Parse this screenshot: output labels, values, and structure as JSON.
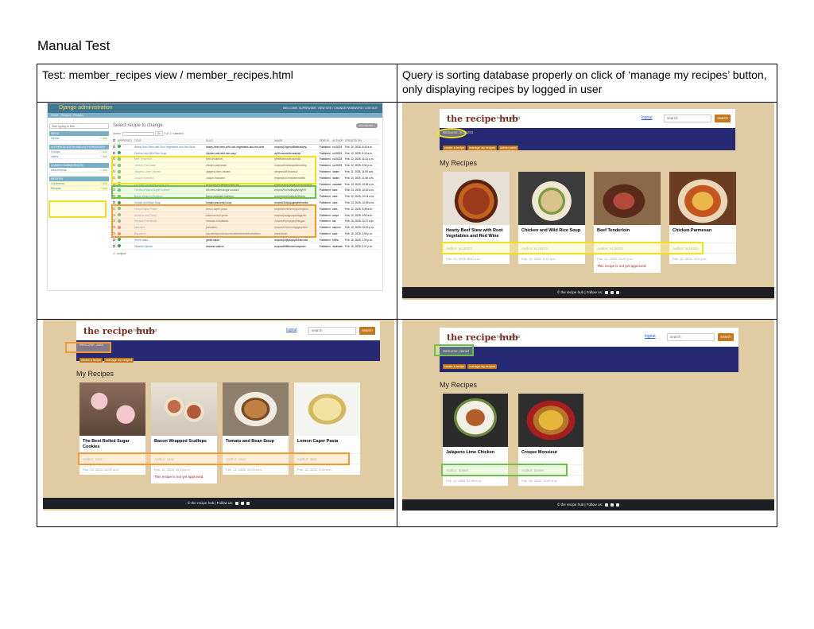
{
  "page": {
    "title": "Manual Test",
    "test_label": "Test:  member_recipes view / member_recipes.html",
    "result_text": "Query is sorting database properly on click of ‘manage my recipes’ button, only displaying recipes by logged in user"
  },
  "admin": {
    "site_title": "Django administration",
    "user_bar": "WELCOME, SUPERUSER. VIEW SITE / CHANGE PASSWORD / LOG OUT",
    "breadcrumb": "Home › Recipes › Recipes",
    "filter_placeholder": "Start typing to filter...",
    "apps": [
      {
        "name": "MENU",
        "models": [
          {
            "label": "Menus",
            "add": "+ Add"
          }
        ]
      },
      {
        "name": "AUTHENTICATION AND AUTHORIZATION",
        "models": [
          {
            "label": "Groups",
            "add": "+ Add"
          },
          {
            "label": "Users",
            "add": "+ Add"
          }
        ]
      },
      {
        "name": "DJANGO SUMMERNOTE",
        "models": [
          {
            "label": "Attachments",
            "add": "+ Add"
          }
        ]
      },
      {
        "name": "RECIPES",
        "models": [
          {
            "label": "Comments",
            "add": "+ Add"
          },
          {
            "label": "Recipes",
            "add": "+ Add"
          }
        ]
      }
    ],
    "heading": "Select recipe to change",
    "add_button": "ADD RECIPE +",
    "actions_label": "Action:",
    "go": "Go",
    "selected": "0 of 17 selected",
    "columns": [
      "APPROVED",
      "TITLE",
      "SLUG",
      "IMAGE",
      "STATUS",
      "AUTHOR",
      "CREATED ON"
    ],
    "rows": [
      {
        "ok": true,
        "title": "Hearty Beef Stew with Root Vegetables and Red Wine",
        "slug": "hearty-beef-stew-with-root-vegetables-and-red-wine",
        "image": "recipes/j2hgmcu8fkebxkbjeyl",
        "status": "Published",
        "author": "sc15223",
        "created": "Feb. 10, 2025, 8:40 a.m."
      },
      {
        "ok": true,
        "title": "Chicken and Wild Rice Soup",
        "slug": "chicken-and-wild-rice-soup",
        "image": "ay02omcmebhmeaniail",
        "status": "Published",
        "author": "sc15223",
        "created": "Feb. 12, 2025, 5:10 a.m."
      },
      {
        "ok": true,
        "title": "Beef Tenderloin",
        "slug": "beef-tenderloin",
        "image": "g9m9ktmmovbvanmolb",
        "status": "Published",
        "author": "sc15223",
        "created": "Feb. 12, 2025, 11:21 p.m."
      },
      {
        "ok": true,
        "title": "Chicken Parmesan",
        "slug": "chicken-parmesan",
        "image": "recipes/ffmtmbivpdhmonf0ny",
        "status": "Published",
        "author": "sc15223",
        "created": "Feb. 12, 2025, 3:51 p.m."
      },
      {
        "ok": true,
        "title": "Jalapeno Lime Chicken",
        "slug": "jalapeno-lime-chicken",
        "image": "xzhgmcu8f7dhduxc4",
        "status": "Published",
        "author": "daniel",
        "created": "Feb. 11, 2025, 11:09 a.m."
      },
      {
        "ok": true,
        "title": "Croque Monsieur",
        "slug": "croque-monsieur",
        "image": "recipes/loi7zrnlvbkrhmoa9y",
        "status": "Published",
        "author": "daniel",
        "created": "Feb. 10, 2025, 11:40 a.m."
      },
      {
        "ok": true,
        "title": "Overnight Breakfast Casserole",
        "slug": "overnight-breakfast-casserole",
        "image": "recipes/jwfgmcuiqivkydhmuddwch",
        "status": "Published",
        "author": "michelle",
        "created": "Feb. 13, 2025, 10:04 a.m."
      },
      {
        "ok": true,
        "title": "The Best Rolled Sugar Cookies",
        "slug": "the-best-rolled-sugar-cookies",
        "image": "recipes/0m0wdbkg8yshgfn9",
        "status": "Published",
        "author": "sara",
        "created": "Feb. 13, 2025, 10:02 a.m."
      },
      {
        "ok": true,
        "title": "Bacon Wrapped Scallops",
        "slug": "bacon-wrapped-scallops",
        "image": "recipes/giqr0wsltu1d38nmq",
        "status": "Published",
        "author": "sara",
        "created": "Feb. 12, 2025, 10:14 a.m."
      },
      {
        "ok": true,
        "title": "Tomato and Bean Soup",
        "slug": "tomato-and-bean-soup",
        "image": "recipes/4htpyqugmgbvfhmhke",
        "status": "Published",
        "author": "sara",
        "created": "Feb. 13, 2025, 10:09 a.m."
      },
      {
        "ok": true,
        "title": "Lemon Caper Pasta",
        "slug": "lemon-caper-pasta",
        "image": "recipes/bzhbewmvyuvvhqkiuu",
        "status": "Published",
        "author": "sara",
        "created": "Feb. 12, 2025, 9:39 a.m."
      },
      {
        "ok": true,
        "title": "Hummus and Pesto",
        "slug": "hummus-and-pesto",
        "image": "recipes/jozsjzpuqcubbgqvfm",
        "status": "Published",
        "author": "tanya",
        "created": "Feb. 10, 2025, 4:52 a.m."
      },
      {
        "ok": true,
        "title": "Mexican Enchiladas",
        "slug": "mexican-enchiladas",
        "image": "recipes/hfp4xpqvbpfhfsgjxz",
        "status": "Published",
        "author": "kat",
        "created": "Feb. 10, 2025, 11:17 a.m."
      },
      {
        "ok": false,
        "title": "pancakes",
        "slug": "pancakes",
        "image": "recipes/hhz1rmmxgqpdyhibid",
        "status": "Published",
        "author": "sammo",
        "created": "Feb. 12, 2025, 12:12 p.m."
      },
      {
        "ok": false,
        "title": "Biscotmtis",
        "slug": "biscotmtiscromkcmunicmeblecfcivmediumstioms",
        "image": "placeholder",
        "status": "Published",
        "author": "sara",
        "created": "Feb. 10, 2025, 2:53 p.m."
      },
      {
        "ok": true,
        "title": "Greek salad",
        "slug": "greek-salad",
        "image": "recipes/p4j8ysqoqt3t4wbco6d",
        "status": "Published",
        "author": "bhilia",
        "created": "Feb. 10, 2025, 1:30 p.m."
      },
      {
        "ok": true,
        "title": "Sesame Salmon",
        "slug": "sesame-salmon",
        "image": "recipes/fbfl6hmcnfmclpecbs",
        "status": "Published",
        "author": "ibrahsam",
        "created": "Feb. 10, 2025, 2:07 p.m."
      }
    ],
    "count": "17 recipes"
  },
  "hub": {
    "brand": "the recipe hub",
    "nav_home": "home",
    "nav_about": "about",
    "logout": "logout",
    "search_placeholder": "search",
    "search_button": "search",
    "create_button": "create a recipe",
    "manage_button": "manage my recipes",
    "admin_button": "admin panel",
    "heading": "My Recipes",
    "footer": "© the recipe hub | Follow us:",
    "not_approved": "This recipe is not yet approved."
  },
  "panels": {
    "sc": {
      "welcome": "Welcome, sc15223",
      "cards": [
        {
          "title": "Hearty Beef Stew with Root Vegetables and Red Wine",
          "author": "Author: sc15223",
          "date": "Feb. 10, 2025, 8:40 a.m.",
          "img": "stew"
        },
        {
          "title": "Chicken and Wild Rice Soup",
          "author": "Author: sc15223",
          "date": "Feb. 12, 2025, 5:10 a.m.",
          "img": "soup"
        },
        {
          "title": "Beef Tenderloin",
          "author": "Author: sc15223",
          "date": "Feb. 12, 2025, 11:20 p.m.",
          "img": "beef",
          "pending": true
        },
        {
          "title": "Chicken Parmesan",
          "author": "Author: sc15223",
          "date": "Feb. 12, 2025, 3:51 p.m.",
          "img": "parm"
        }
      ]
    },
    "sara": {
      "welcome": "Welcome, sara",
      "cards": [
        {
          "title": "The Best Rolled Sugar Cookies",
          "author": "Author: sara",
          "date": "Feb. 13, 2025, 10:02 a.m.",
          "img": "cookies"
        },
        {
          "title": "Bacon Wrapped Scallops",
          "author": "Author: sara",
          "date": "Feb. 12, 2025, 10:14 a.m.",
          "img": "bacon",
          "pending": true
        },
        {
          "title": "Tomato and Bean Soup",
          "author": "Author: sara",
          "date": "Feb. 13, 2025, 10:09 a.m.",
          "img": "tomsoup"
        },
        {
          "title": "Lemon Caper Pasta",
          "author": "Author: sara",
          "date": "Feb. 12, 2025, 9:39 a.m.",
          "img": "pasta"
        }
      ]
    },
    "daniel": {
      "welcome": "Welcome, daniel",
      "cards": [
        {
          "title": "Jalapeno Lime Chicken",
          "author": "Author: daniel",
          "date": "Feb. 11, 2025, 11:09 a.m.",
          "img": "lime"
        },
        {
          "title": "Croque Monsieur",
          "author": "Author: daniel",
          "date": "Feb. 10, 2025, 11:40 a.m.",
          "img": "croque"
        }
      ]
    }
  },
  "colors": {
    "yellow_highlight": "#f0e020",
    "green_highlight": "#6dc04a",
    "orange_highlight": "#f29a30",
    "hub_background": "#e0cba2",
    "hub_band": "#262a72",
    "hub_button": "#c47a1c",
    "admin_header": "#417690"
  }
}
